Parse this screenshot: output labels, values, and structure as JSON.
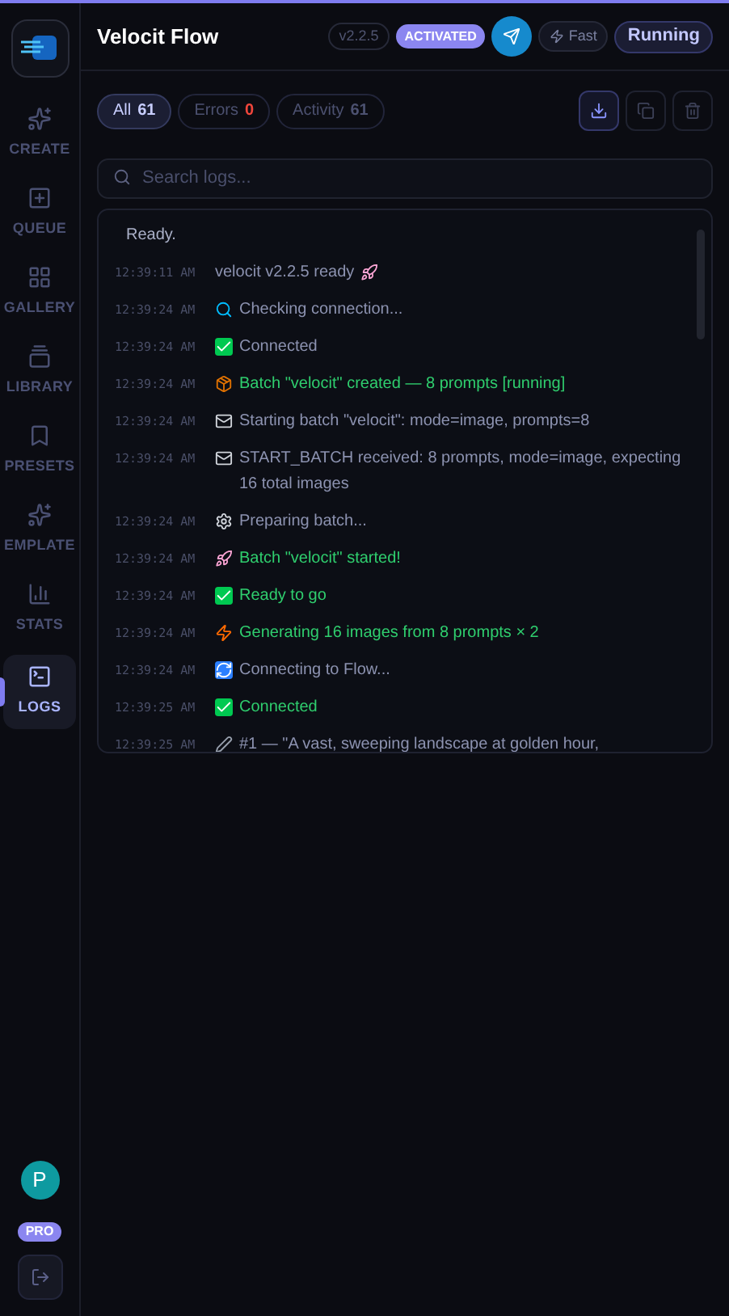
{
  "app": {
    "title": "Velocit Flow",
    "version": "v2.2.5",
    "license": "ACTIVATED",
    "speed": "Fast",
    "status": "Running"
  },
  "sidebar": {
    "items": [
      {
        "label": "CREATE",
        "kind": "sparkles",
        "selected": false
      },
      {
        "label": "QUEUE",
        "kind": "queue",
        "selected": false
      },
      {
        "label": "GALLERY",
        "kind": "grid",
        "selected": false
      },
      {
        "label": "LIBRARY",
        "kind": "library",
        "selected": false
      },
      {
        "label": "PRESETS",
        "kind": "bookmark",
        "selected": false
      },
      {
        "label": "EMPLATE",
        "kind": "sparkles",
        "selected": false
      },
      {
        "label": "STATS",
        "kind": "chart",
        "selected": false
      },
      {
        "label": "LOGS",
        "kind": "terminal",
        "selected": true
      }
    ],
    "avatar": "P",
    "plan": "PRO"
  },
  "filters": [
    {
      "label": "All",
      "count": "61",
      "selected": true,
      "alert": false
    },
    {
      "label": "Errors",
      "count": "0",
      "selected": false,
      "alert": true
    },
    {
      "label": "Activity",
      "count": "61",
      "selected": false,
      "alert": false
    }
  ],
  "search": {
    "placeholder": "Search logs..."
  },
  "log": {
    "status": "Ready.",
    "lines": [
      {
        "time": "12:39:11 AM",
        "kind": "trail_rocket",
        "text": "velocit v2.2.5 ready",
        "success": false
      },
      {
        "time": "12:39:24 AM",
        "kind": "search",
        "text": "Checking connection...",
        "success": false
      },
      {
        "time": "12:39:24 AM",
        "kind": "check",
        "text": "Connected",
        "success": false
      },
      {
        "time": "12:39:24 AM",
        "kind": "package",
        "text": "Batch \"velocit\" created — 8 prompts [running]",
        "success": true
      },
      {
        "time": "12:39:24 AM",
        "kind": "mail",
        "text": "Starting batch \"velocit\": mode=image, prompts=8",
        "success": false
      },
      {
        "time": "12:39:24 AM",
        "kind": "mail",
        "text": "START_BATCH received: 8 prompts, mode=image, expecting 16 total images",
        "success": false
      },
      {
        "time": "12:39:24 AM",
        "kind": "gear",
        "text": "Preparing batch...",
        "success": false
      },
      {
        "time": "12:39:24 AM",
        "kind": "rocket",
        "text": "Batch \"velocit\" started!",
        "success": true
      },
      {
        "time": "12:39:24 AM",
        "kind": "check",
        "text": "Ready to go",
        "success": true
      },
      {
        "time": "12:39:24 AM",
        "kind": "zap",
        "text": "Generating 16 images from 8 prompts × 2",
        "success": true
      },
      {
        "time": "12:39:24 AM",
        "kind": "refresh",
        "text": "Connecting to Flow...",
        "success": false
      },
      {
        "time": "12:39:25 AM",
        "kind": "check",
        "text": "Connected",
        "success": true
      },
      {
        "time": "12:39:25 AM",
        "kind": "pen",
        "text": "#1 — \"A vast, sweeping landscape at golden hour,",
        "success": false
      }
    ]
  }
}
